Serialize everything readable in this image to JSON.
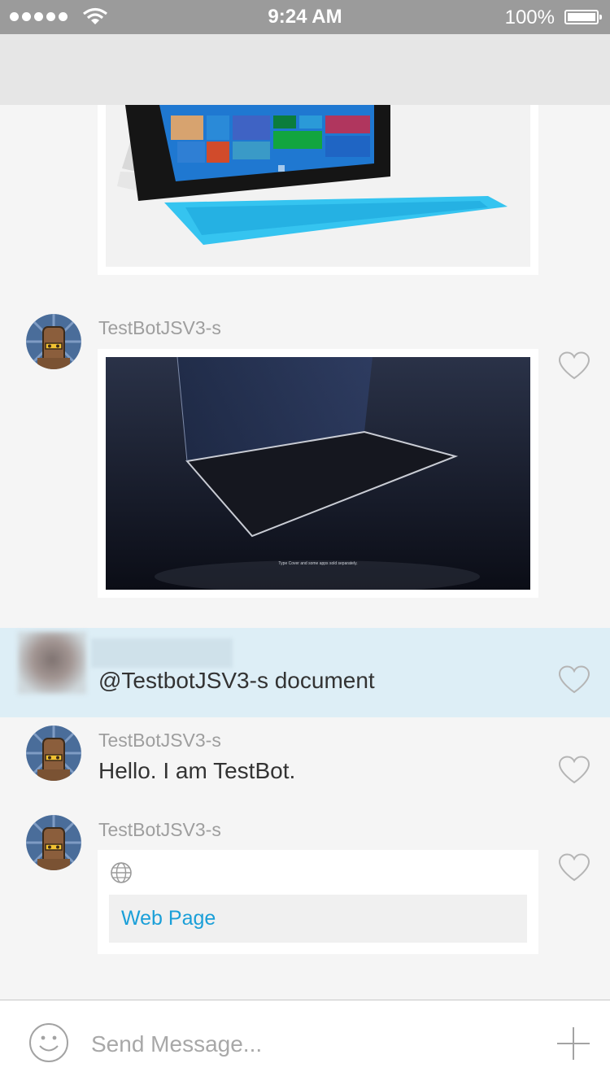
{
  "status_bar": {
    "time": "9:24 AM",
    "battery": "100%"
  },
  "messages": [
    {
      "sender": "TestBotJSV3-s",
      "type": "image"
    },
    {
      "sender": "",
      "text": "@TestbotJSV3-s document",
      "highlighted": true
    },
    {
      "sender": "TestBotJSV3-s",
      "text": "Hello. I am TestBot."
    },
    {
      "sender": "TestBotJSV3-s",
      "link_title": "Web Page"
    }
  ],
  "video_caption": "Type Cover and some apps sold separately.",
  "composer": {
    "placeholder": "Send Message..."
  },
  "colors": {
    "link": "#1a9fd8",
    "highlight": "#ddeef6",
    "status_bar": "#9b9b9b",
    "nav_bar": "#e6e6e6"
  }
}
